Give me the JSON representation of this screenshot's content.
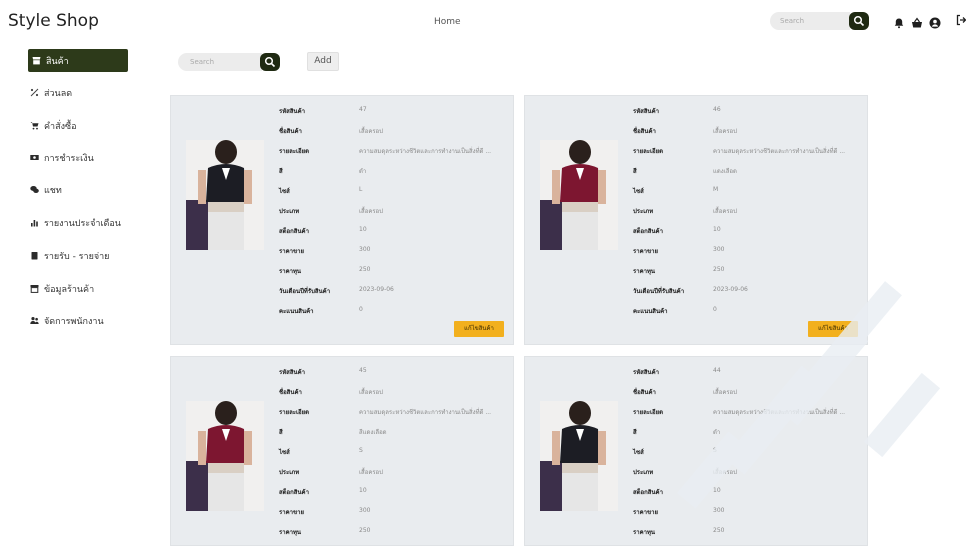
{
  "app": {
    "brand": "Style Shop",
    "home_link": "Home"
  },
  "top_search": {
    "placeholder": "Search"
  },
  "sidebar": {
    "items": [
      {
        "label": "สินค้า",
        "icon": "store-icon",
        "active": true
      },
      {
        "label": "ส่วนลด",
        "icon": "percent-icon",
        "active": false
      },
      {
        "label": "คำสั่งซื้อ",
        "icon": "cart-icon",
        "active": false
      },
      {
        "label": "การชำระเงิน",
        "icon": "money-icon",
        "active": false
      },
      {
        "label": "แชท",
        "icon": "chat-icon",
        "active": false
      },
      {
        "label": "รายงานประจำเดือน",
        "icon": "chart-icon",
        "active": false
      },
      {
        "label": "รายรับ - รายจ่าย",
        "icon": "wallet-icon",
        "active": false
      },
      {
        "label": "ข้อมูลร้านค้า",
        "icon": "shop-icon",
        "active": false
      },
      {
        "label": "จัดการพนักงาน",
        "icon": "users-icon",
        "active": false
      }
    ]
  },
  "toolbar": {
    "search_placeholder": "Search",
    "add_label": "Add"
  },
  "field_labels": [
    "รหัสสินค้า",
    "ชื่อสินค้า",
    "รายละเอียด",
    "สี",
    "ไซส์",
    "ประเภท",
    "สต็อกสินค้า",
    "ราคาขาย",
    "ราคาทุน",
    "วันเดือนปีที่รับสินค้า",
    "คะแนนสินค้า"
  ],
  "edit_label": "แก้ไขสินค้า",
  "products": [
    {
      "values": [
        "47",
        "เสื้อครอป",
        "ความสมดุลระหว่างชีวิตและการทำงานเป็นสิ่งที่ดี ...",
        "ดำ",
        "L",
        "เสื้อครอป",
        "10",
        "300",
        "250",
        "2023-09-06",
        "0"
      ],
      "shirt_color": "#1c1d24"
    },
    {
      "values": [
        "46",
        "เสื้อครอป",
        "ความสมดุลระหว่างชีวิตและการทำงานเป็นสิ่งที่ดี ...",
        "แดงเลือด",
        "M",
        "เสื้อครอป",
        "10",
        "300",
        "250",
        "2023-09-06",
        "0"
      ],
      "shirt_color": "#7d1630"
    },
    {
      "values": [
        "45",
        "เสื้อครอป",
        "ความสมดุลระหว่างชีวิตและการทำงานเป็นสิ่งที่ดี ...",
        "สีแดงเลือด",
        "S",
        "เสื้อครอป",
        "10",
        "300",
        "250"
      ],
      "shirt_color": "#7d1630"
    },
    {
      "values": [
        "44",
        "เสื้อครอป",
        "ความสมดุลระหว่างชีวิตและการทำงานเป็นสิ่งที่ดี ...",
        "ดำ",
        "S",
        "เสื้อครอป",
        "10",
        "300",
        "250"
      ],
      "shirt_color": "#1c1d24"
    }
  ],
  "colors": {
    "accent": "#2d3a1a",
    "edit_button": "#f2b01e",
    "card_bg": "#e9ecef"
  }
}
